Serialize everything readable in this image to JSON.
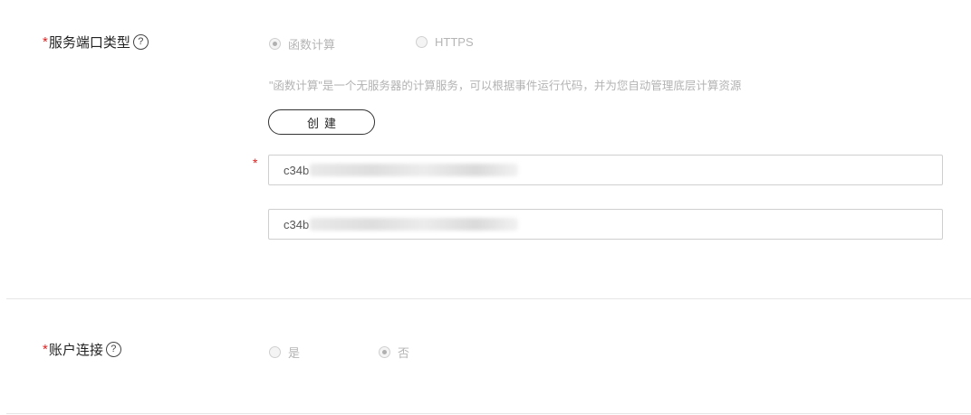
{
  "service_port": {
    "label": "服务端口类型",
    "required_mark": "*",
    "help_glyph": "?",
    "options": [
      {
        "label": "函数计算",
        "checked": true
      },
      {
        "label": "HTTPS",
        "checked": false
      }
    ],
    "hint": "\"函数计算\"是一个无服务器的计算服务，可以根据事件运行代码，并为您自动管理底层计算资源",
    "create_button": "创建",
    "input_required_mark": "*",
    "inputs": [
      {
        "value": "c34b"
      },
      {
        "value": "c34b"
      }
    ]
  },
  "account_link": {
    "label": "账户连接",
    "required_mark": "*",
    "help_glyph": "?",
    "options": [
      {
        "label": "是",
        "checked": false
      },
      {
        "label": "否",
        "checked": true
      }
    ]
  }
}
